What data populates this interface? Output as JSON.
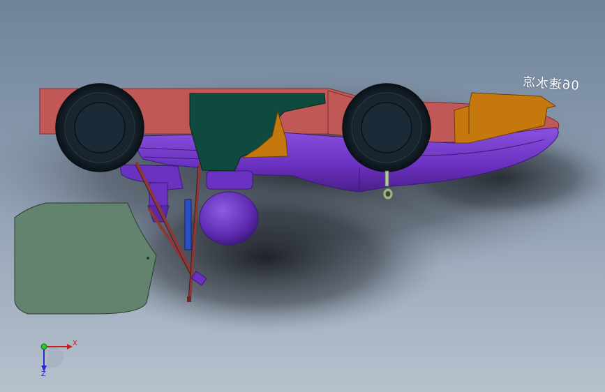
{
  "viewport": {
    "model_label": "06速水凉",
    "triad": {
      "x_label": "X",
      "z_label": "Z"
    }
  },
  "colors": {
    "body_red": "#c05858",
    "body_purple": "#6d34c0",
    "tire": "#1c2a36",
    "green_panel": "#0f4a3e",
    "orange": "#c4780d",
    "rods": "#8b3838",
    "blue_bar": "#2a4ec8",
    "platform": "#62836e",
    "background": "#7c8fa6"
  }
}
